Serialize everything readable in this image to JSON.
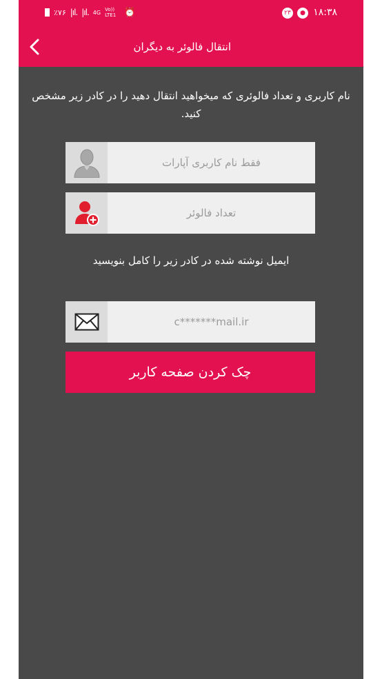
{
  "status_bar": {
    "time": "۱۸:۳۸",
    "notification_badge": "۲۳",
    "battery": "٪۷۶",
    "network_4g": "4G",
    "volte": "Vo)) LTE1"
  },
  "app_bar": {
    "title": "انتقال فالوئر به دیگران",
    "back_icon": "chevron-left-icon"
  },
  "instructions": "نام کاربری و تعداد فالوئری که میخواهید انتقال دهید را در کادر زیر مشخص کنید.",
  "username_field": {
    "placeholder": "فقط نام کاربری آپارات",
    "icon": "user-avatar-icon"
  },
  "followers_field": {
    "placeholder": "تعداد فالوئر",
    "icon": "add-user-icon"
  },
  "email_instruction": "ایمیل نوشته شده در کادر زیر را کامل بنویسید",
  "email_field": {
    "placeholder": "c*******mail.ir",
    "icon": "envelope-icon"
  },
  "check_button": {
    "label": "چک کردن صفحه کاربر"
  },
  "colors": {
    "accent": "#e3114f",
    "background": "#494949",
    "field_bg": "#efefef",
    "icon_box_bg": "#dcdcdc"
  }
}
